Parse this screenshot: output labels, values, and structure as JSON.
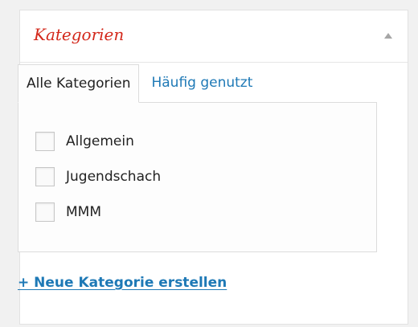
{
  "box": {
    "title": "Kategorien",
    "toggle_icon": "collapse-arrow-up-icon"
  },
  "tabs": [
    {
      "label": "Alle Kategorien",
      "active": true
    },
    {
      "label": "Häufig genutzt",
      "active": false
    }
  ],
  "categories": [
    {
      "label": "Allgemein",
      "checked": false
    },
    {
      "label": "Jugendschach",
      "checked": false
    },
    {
      "label": "MMM",
      "checked": false
    }
  ],
  "add_link": {
    "label": "+ Neue Kategorie erstellen"
  },
  "colors": {
    "title": "#d3281b",
    "link": "#1e79b6",
    "text": "#222222",
    "border": "#dcdcdc",
    "background": "#f1f1f1"
  }
}
